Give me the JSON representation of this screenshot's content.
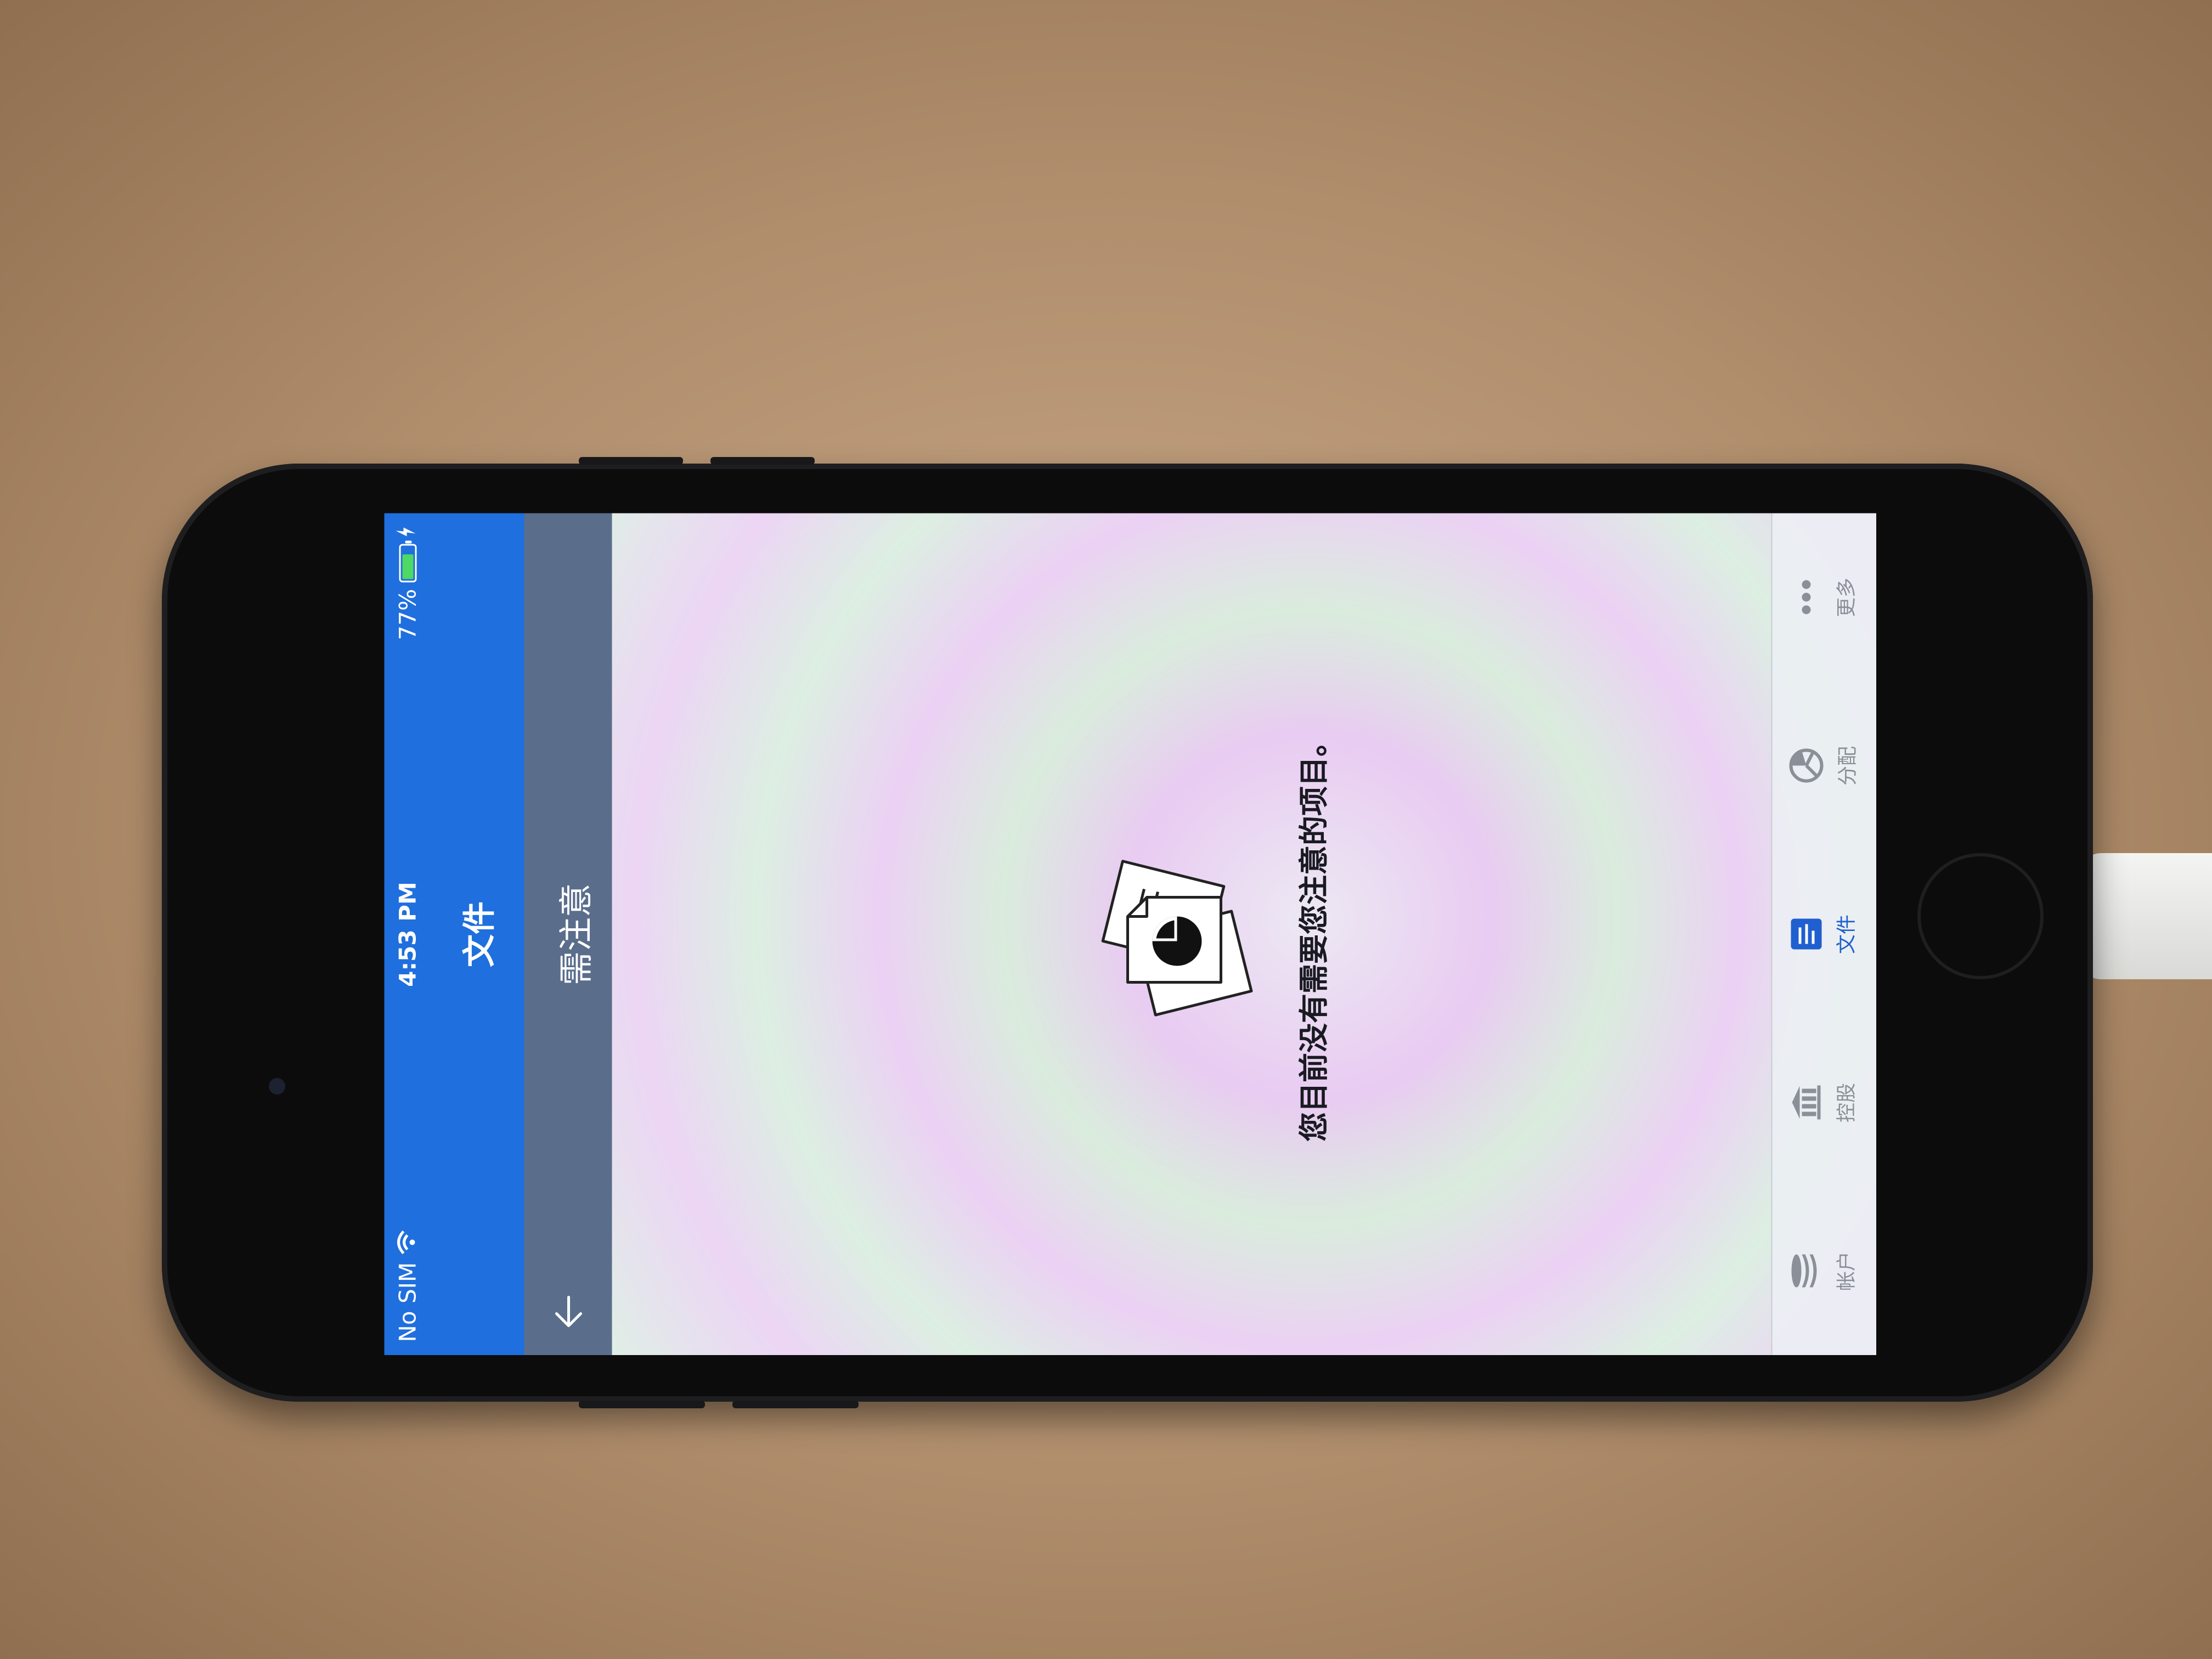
{
  "status_bar": {
    "carrier": "No SIM",
    "time": "4:53 PM",
    "battery_percent_label": "77%",
    "battery_level": 0.77
  },
  "nav": {
    "title": "文件",
    "subtitle": "需注意"
  },
  "content": {
    "empty_message": "您目前没有需要您注意的项目。"
  },
  "tabs": [
    {
      "label": "帐户",
      "icon": "coins-stack-icon",
      "active": false
    },
    {
      "label": "控股",
      "icon": "bank-building-icon",
      "active": false
    },
    {
      "label": "文件",
      "icon": "document-list-icon",
      "active": true
    },
    {
      "label": "分配",
      "icon": "pie-globe-icon",
      "active": false
    },
    {
      "label": "更多",
      "icon": "more-dots-icon",
      "active": false
    }
  ],
  "colors": {
    "header_blue": "#1f6fde",
    "subbar": "#5a6e8c",
    "active_tab": "#1f5fd0"
  }
}
